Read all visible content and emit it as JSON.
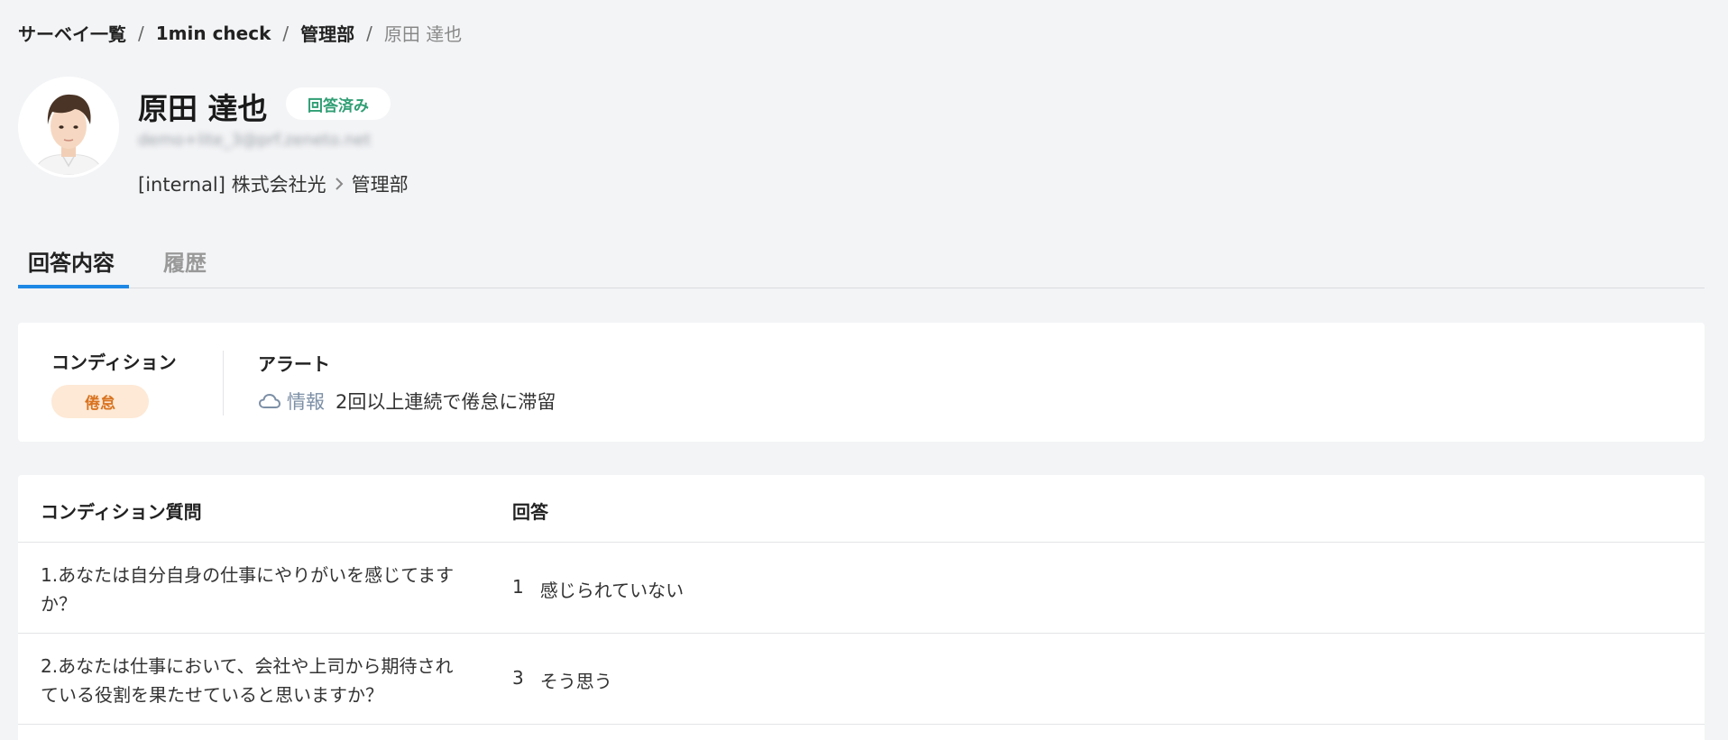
{
  "breadcrumb": {
    "items": [
      "サーベイ一覧",
      "1min check",
      "管理部"
    ],
    "current": "原田 達也",
    "separator": "/"
  },
  "profile": {
    "name": "原田 達也",
    "status": "回答済み",
    "email": "demo+lite_3@prf.zeneto.net",
    "org": "[internal] 株式会社光",
    "department": "管理部"
  },
  "tabs": [
    {
      "label": "回答内容",
      "active": true
    },
    {
      "label": "履歴",
      "active": false
    }
  ],
  "condition": {
    "title": "コンディション",
    "value": "倦怠"
  },
  "alert": {
    "title": "アラート",
    "level": "情報",
    "message": "2回以上連続で倦怠に滞留"
  },
  "table": {
    "headers": [
      "コンディション質問",
      "回答"
    ],
    "rows": [
      {
        "question": "1.あなたは自分自身の仕事にやりがいを感じてますか？",
        "answer_num": "1",
        "answer_text": "感じられていない"
      },
      {
        "question": "2.あなたは仕事において、会社や上司から期待されている役割を果たせていると思いますか？",
        "answer_num": "3",
        "answer_text": "そう思う"
      }
    ]
  },
  "colors": {
    "background": "#f3f4f6",
    "accent": "#1e88e5",
    "status_green": "#2f9e74",
    "condition_orange": "#d9731f",
    "condition_bg": "#fde9d6"
  },
  "icons": {
    "chevron": "chevron-right-icon",
    "alert": "cloud-icon"
  }
}
